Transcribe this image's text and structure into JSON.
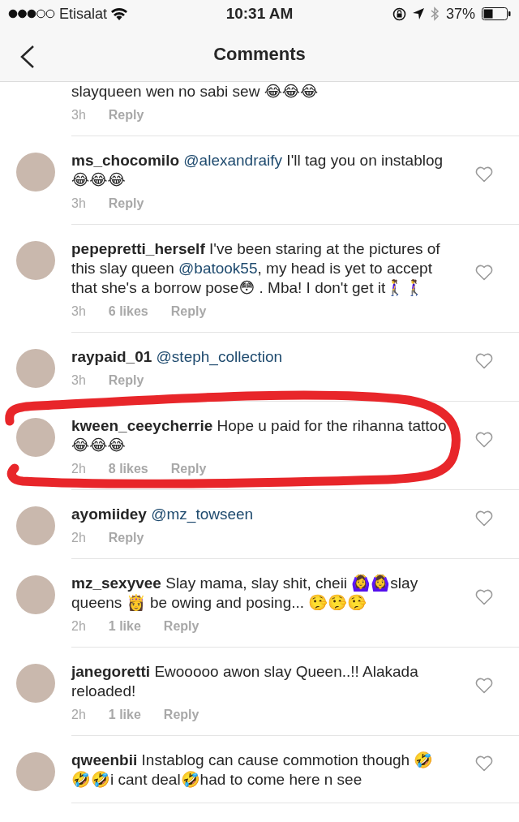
{
  "status_bar": {
    "carrier": "Etisalat",
    "time": "10:31 AM",
    "battery": "37%"
  },
  "header": {
    "title": "Comments"
  },
  "comments": [
    {
      "highlighted": false,
      "parts": [
        {
          "kind": "text",
          "text": "slayqueen wen no sabi sew 😂😂😂"
        }
      ],
      "time": "3h",
      "reply": "Reply"
    },
    {
      "highlighted": false,
      "username": "ms_chocomilo",
      "parts": [
        {
          "kind": "mention",
          "text": "@alexandraify"
        },
        {
          "kind": "text",
          "text": " I'll tag you on instablog 😂😂😂"
        }
      ],
      "time": "3h",
      "reply": "Reply"
    },
    {
      "highlighted": false,
      "username": "pepepretti_herself",
      "parts": [
        {
          "kind": "text",
          "text": "I've been staring at the pictures of this slay queen "
        },
        {
          "kind": "mention",
          "text": "@batook55"
        },
        {
          "kind": "text",
          "text": ", my head is yet to accept that she's a borrow pose😳 . Mba! I don't get it🚶‍♀️🚶‍♀️"
        }
      ],
      "time": "3h",
      "likes": "6 likes",
      "reply": "Reply"
    },
    {
      "highlighted": false,
      "username": "raypaid_01",
      "parts": [
        {
          "kind": "mention",
          "text": "@steph_collection"
        }
      ],
      "time": "3h",
      "reply": "Reply"
    },
    {
      "highlighted": true,
      "username": "kween_ceeycherrie",
      "parts": [
        {
          "kind": "text",
          "text": "Hope u paid for the rihanna tattoo😂😂😂"
        }
      ],
      "time": "2h",
      "likes": "8 likes",
      "reply": "Reply"
    },
    {
      "highlighted": false,
      "username": "ayomiidey",
      "parts": [
        {
          "kind": "mention",
          "text": "@mz_towseen"
        }
      ],
      "time": "2h",
      "reply": "Reply"
    },
    {
      "highlighted": false,
      "username": "mz_sexyvee",
      "parts": [
        {
          "kind": "text",
          "text": "Slay mama, slay shit, cheii 🙆‍♀️🙆‍♀️slay queens 👸  be owing and posing... 🤥🤥🤥"
        }
      ],
      "time": "2h",
      "likes": "1 like",
      "reply": "Reply"
    },
    {
      "highlighted": false,
      "username": "janegoretti",
      "parts": [
        {
          "kind": "text",
          "text": "Ewooooo awon slay Queen..!! Alakada reloaded!"
        }
      ],
      "time": "2h",
      "likes": "1 like",
      "reply": "Reply"
    },
    {
      "highlighted": false,
      "username": "qweenbii",
      "parts": [
        {
          "kind": "text",
          "text": "Instablog can cause commotion though 🤣🤣🤣i cant deal🤣had to come here n see"
        }
      ]
    }
  ]
}
